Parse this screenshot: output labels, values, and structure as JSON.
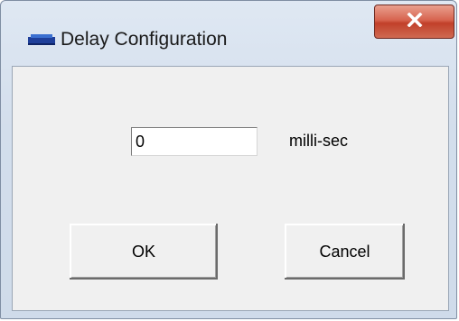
{
  "window": {
    "title": "Delay Configuration",
    "icon": "app-icon",
    "close_icon": "close-icon"
  },
  "form": {
    "delay_value": "0",
    "unit_label": "milli-sec"
  },
  "buttons": {
    "ok_label": "OK",
    "cancel_label": "Cancel"
  },
  "colors": {
    "close_button": "#d7644f",
    "titlebar": "#d3deec",
    "client_bg": "#f0f0f0"
  }
}
